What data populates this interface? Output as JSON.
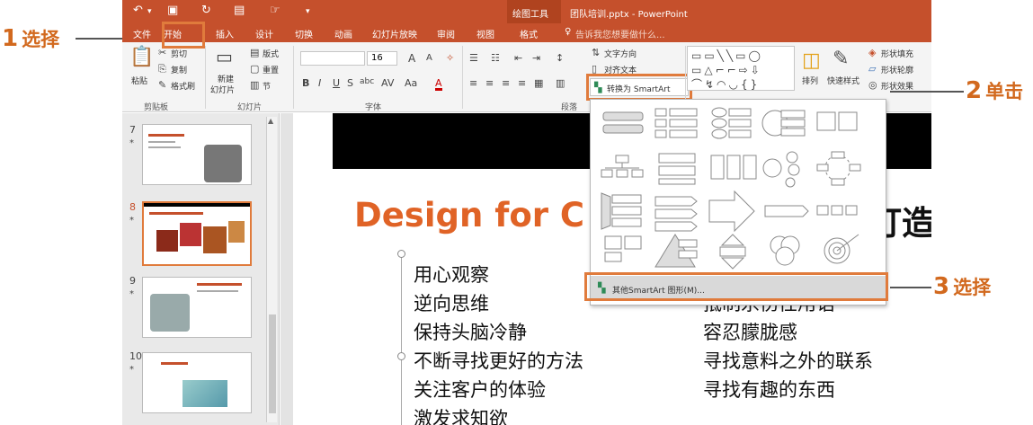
{
  "annotations": {
    "step1": {
      "num": "1",
      "label": "选择"
    },
    "step2": {
      "num": "2",
      "label": "单击"
    },
    "step3": {
      "num": "3",
      "label": "选择"
    }
  },
  "titlebar": {
    "context_tab": "绘图工具",
    "title": "团队培训.pptx - PowerPoint"
  },
  "tabs": [
    "文件",
    "开始",
    "插入",
    "设计",
    "切换",
    "动画",
    "幻灯片放映",
    "审阅",
    "视图",
    "格式"
  ],
  "tell_me": "告诉我您想要做什么...",
  "ribbon": {
    "clipboard": {
      "paste": "粘贴",
      "cut": "剪切",
      "copy": "复制",
      "format_painter": "格式刷",
      "label": "剪贴板"
    },
    "slides": {
      "new_slide_l1": "新建",
      "new_slide_l2": "幻灯片",
      "layout": "版式",
      "reset": "重置",
      "section": "节",
      "label": "幻灯片"
    },
    "font": {
      "size": "16",
      "label": "字体"
    },
    "paragraph": {
      "text_direction": "文字方向",
      "align_text": "对齐文本",
      "convert_smartart": "转换为 SmartArt",
      "label": "段落"
    },
    "drawing": {
      "arrange": "排列",
      "quick_styles": "快速样式",
      "shape_fill": "形状填充",
      "shape_outline": "形状轮廓",
      "shape_effects": "形状效果"
    }
  },
  "thumbnails": [
    {
      "num": "7",
      "star": "*"
    },
    {
      "num": "8",
      "star": "*"
    },
    {
      "num": "9",
      "star": "*"
    },
    {
      "num": "10",
      "star": "*"
    }
  ],
  "slide": {
    "title_left": "Design for C",
    "title_right": "打造",
    "left_items": [
      "用心观察",
      "逆向思维",
      "保持头脑冷静",
      "不断寻找更好的方法",
      "关注客户的体验",
      "激发求知欲"
    ],
    "right_items": [
      "抵制杀伤性用语",
      "容忍朦胧感",
      "寻找意料之外的联系",
      "寻找有趣的东西"
    ]
  },
  "dropdown": {
    "more_label": "其他SmartArt 图形(M)..."
  },
  "colors": {
    "accent": "#c5502c",
    "annotation": "#d2691e",
    "highlight": "#e07b3c"
  }
}
